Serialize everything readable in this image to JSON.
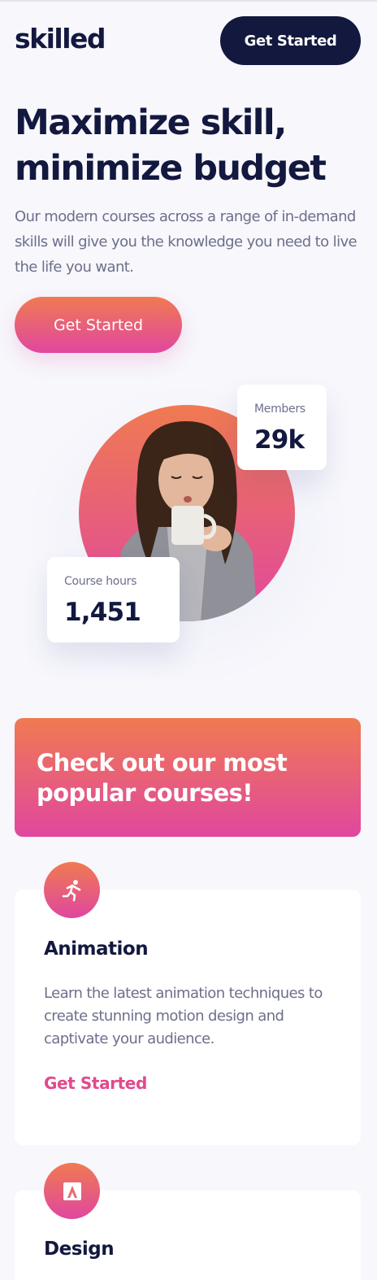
{
  "header": {
    "logo": "skilled",
    "cta_label": "Get Started"
  },
  "hero": {
    "title": "Maximize skill, minimize budget",
    "description": "Our modern courses across a range of in-demand skills will give you the knowledge you need to live the life you want.",
    "cta_label": "Get Started"
  },
  "stats": {
    "members": {
      "label": "Members",
      "value": "29k"
    },
    "course_hours": {
      "label": "Course hours",
      "value": "1,451"
    }
  },
  "popular": {
    "title": "Check out our most popular courses!"
  },
  "courses": [
    {
      "icon": "running-person-icon",
      "title": "Animation",
      "description": "Learn the latest animation techniques to create stunning motion design and captivate your audience.",
      "link_label": "Get Started"
    },
    {
      "icon": "design-icon",
      "title": "Design"
    }
  ],
  "colors": {
    "navy": "#13183f",
    "gradient_start": "#f07a51",
    "gradient_end": "#e0479f",
    "body_text": "#6d6f8c",
    "link": "#e04a8c",
    "background": "#f7f7fc"
  }
}
